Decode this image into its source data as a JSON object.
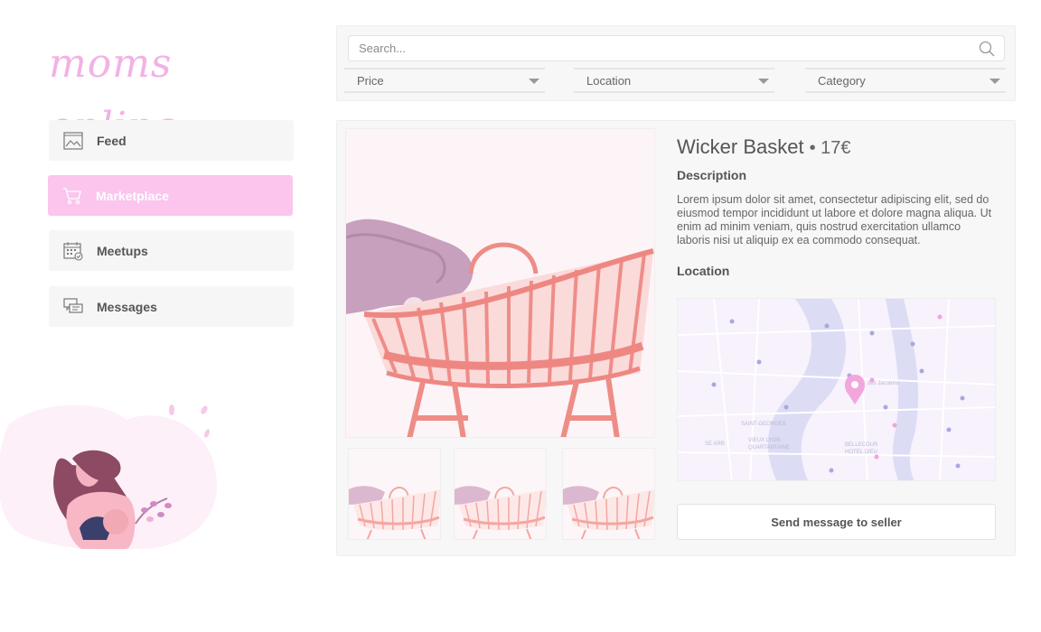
{
  "logo": "moms online",
  "sidebar": {
    "items": [
      {
        "label": "Feed",
        "icon": "image-icon"
      },
      {
        "label": "Marketplace",
        "icon": "cart-icon",
        "active": true
      },
      {
        "label": "Meetups",
        "icon": "calendar-icon"
      },
      {
        "label": "Messages",
        "icon": "chat-icon"
      }
    ]
  },
  "search": {
    "placeholder": "Search..."
  },
  "filters": {
    "price": "Price",
    "location": "Location",
    "category": "Category"
  },
  "product": {
    "title": "Wicker Basket",
    "price": "• 17€",
    "description_heading": "Description",
    "description": "Lorem ipsum dolor sit amet, consectetur adipiscing elit, sed do eiusmod tempor incididunt ut labore et dolore magna aliqua. Ut enim ad minim veniam, quis nostrud exercitation ullamco laboris nisi ut aliquip ex ea commodo consequat.",
    "location_heading": "Location",
    "send_button": "Send message to seller"
  },
  "map_labels": {
    "l1": "SAINT-GEORGES",
    "l2": "VIEUX LYON",
    "l3": "QUARTANTAINE",
    "l4": "BELLECOUR",
    "l5": "HOTEL DIEU",
    "l6": "SE ARR",
    "l7": "des Jacobins"
  },
  "colors": {
    "accent": "#fbc5ee",
    "logo": "#f2b2e5",
    "panel": "#f7f7f7",
    "basket": "#f08a86"
  }
}
